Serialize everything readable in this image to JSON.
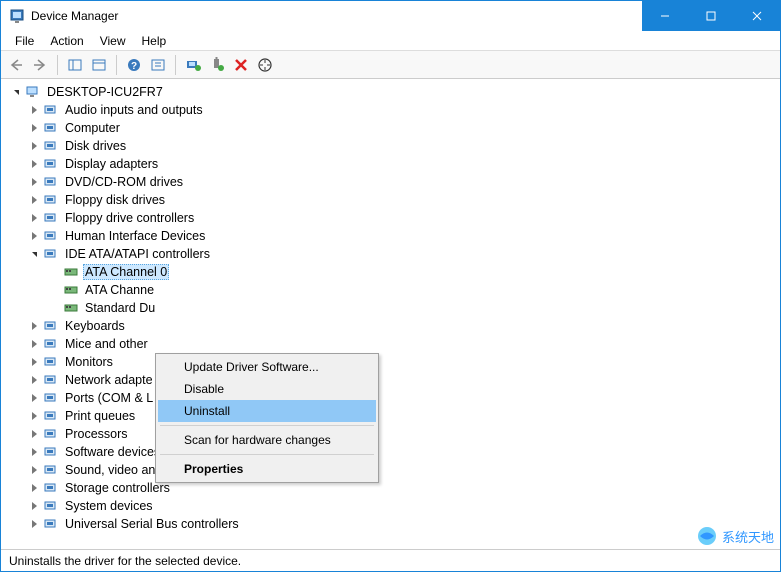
{
  "titlebar": {
    "title": "Device Manager"
  },
  "menubar": {
    "items": [
      "File",
      "Action",
      "View",
      "Help"
    ]
  },
  "tree": {
    "root": "DESKTOP-ICU2FR7",
    "categories": [
      {
        "label": "Audio inputs and outputs"
      },
      {
        "label": "Computer"
      },
      {
        "label": "Disk drives"
      },
      {
        "label": "Display adapters"
      },
      {
        "label": "DVD/CD-ROM drives"
      },
      {
        "label": "Floppy disk drives"
      },
      {
        "label": "Floppy drive controllers"
      },
      {
        "label": "Human Interface Devices"
      },
      {
        "label": "IDE ATA/ATAPI controllers",
        "expanded": true,
        "children": [
          {
            "label": "ATA Channel 0",
            "selected": true
          },
          {
            "label": "ATA Channe"
          },
          {
            "label": "Standard Du"
          }
        ]
      },
      {
        "label": "Keyboards"
      },
      {
        "label": "Mice and other"
      },
      {
        "label": "Monitors"
      },
      {
        "label": "Network adapte"
      },
      {
        "label": "Ports (COM & L"
      },
      {
        "label": "Print queues"
      },
      {
        "label": "Processors"
      },
      {
        "label": "Software devices"
      },
      {
        "label": "Sound, video and game controllers"
      },
      {
        "label": "Storage controllers"
      },
      {
        "label": "System devices"
      },
      {
        "label": "Universal Serial Bus controllers"
      }
    ]
  },
  "context_menu": {
    "items": [
      {
        "label": "Update Driver Software..."
      },
      {
        "label": "Disable"
      },
      {
        "label": "Uninstall",
        "highlight": true
      },
      {
        "sep": true
      },
      {
        "label": "Scan for hardware changes"
      },
      {
        "sep": true
      },
      {
        "label": "Properties",
        "bold": true
      }
    ]
  },
  "statusbar": {
    "text": "Uninstalls the driver for the selected device."
  },
  "watermark": {
    "text": "系统天地"
  }
}
